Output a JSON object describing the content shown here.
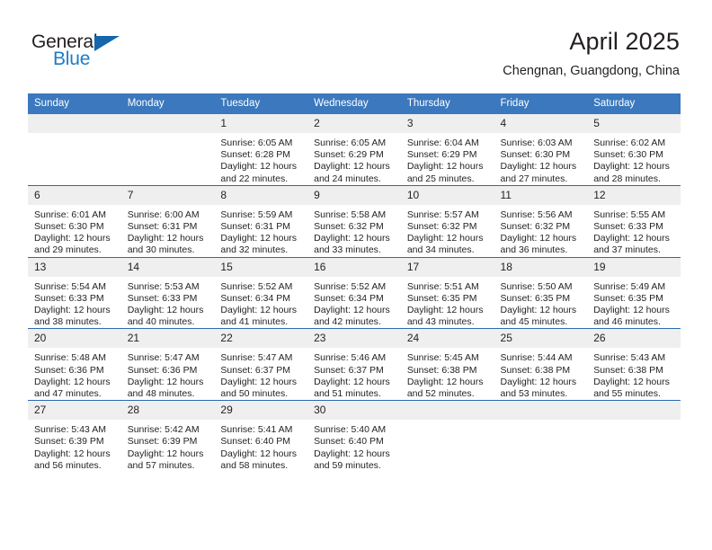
{
  "brand": {
    "name_part1": "General",
    "name_part2": "Blue",
    "triangle_icon": "triangle-icon",
    "accent_blue": "#1c7cc7",
    "triangle_blue": "#1566ab"
  },
  "header": {
    "title": "April 2025",
    "location": "Chengnan, Guangdong, China"
  },
  "theme": {
    "header_row_bg": "#3b78bd",
    "day_band_bg": "#efefef",
    "row_divider": "#2a6aae",
    "text": "#231f20"
  },
  "weekday_headers": [
    "Sunday",
    "Monday",
    "Tuesday",
    "Wednesday",
    "Thursday",
    "Friday",
    "Saturday"
  ],
  "weeks": [
    [
      {
        "day": "",
        "sunrise": "",
        "sunset": "",
        "daylight_line1": "",
        "daylight_line2": ""
      },
      {
        "day": "",
        "sunrise": "",
        "sunset": "",
        "daylight_line1": "",
        "daylight_line2": ""
      },
      {
        "day": "1",
        "sunrise": "Sunrise: 6:05 AM",
        "sunset": "Sunset: 6:28 PM",
        "daylight_line1": "Daylight: 12 hours",
        "daylight_line2": "and 22 minutes."
      },
      {
        "day": "2",
        "sunrise": "Sunrise: 6:05 AM",
        "sunset": "Sunset: 6:29 PM",
        "daylight_line1": "Daylight: 12 hours",
        "daylight_line2": "and 24 minutes."
      },
      {
        "day": "3",
        "sunrise": "Sunrise: 6:04 AM",
        "sunset": "Sunset: 6:29 PM",
        "daylight_line1": "Daylight: 12 hours",
        "daylight_line2": "and 25 minutes."
      },
      {
        "day": "4",
        "sunrise": "Sunrise: 6:03 AM",
        "sunset": "Sunset: 6:30 PM",
        "daylight_line1": "Daylight: 12 hours",
        "daylight_line2": "and 27 minutes."
      },
      {
        "day": "5",
        "sunrise": "Sunrise: 6:02 AM",
        "sunset": "Sunset: 6:30 PM",
        "daylight_line1": "Daylight: 12 hours",
        "daylight_line2": "and 28 minutes."
      }
    ],
    [
      {
        "day": "6",
        "sunrise": "Sunrise: 6:01 AM",
        "sunset": "Sunset: 6:30 PM",
        "daylight_line1": "Daylight: 12 hours",
        "daylight_line2": "and 29 minutes."
      },
      {
        "day": "7",
        "sunrise": "Sunrise: 6:00 AM",
        "sunset": "Sunset: 6:31 PM",
        "daylight_line1": "Daylight: 12 hours",
        "daylight_line2": "and 30 minutes."
      },
      {
        "day": "8",
        "sunrise": "Sunrise: 5:59 AM",
        "sunset": "Sunset: 6:31 PM",
        "daylight_line1": "Daylight: 12 hours",
        "daylight_line2": "and 32 minutes."
      },
      {
        "day": "9",
        "sunrise": "Sunrise: 5:58 AM",
        "sunset": "Sunset: 6:32 PM",
        "daylight_line1": "Daylight: 12 hours",
        "daylight_line2": "and 33 minutes."
      },
      {
        "day": "10",
        "sunrise": "Sunrise: 5:57 AM",
        "sunset": "Sunset: 6:32 PM",
        "daylight_line1": "Daylight: 12 hours",
        "daylight_line2": "and 34 minutes."
      },
      {
        "day": "11",
        "sunrise": "Sunrise: 5:56 AM",
        "sunset": "Sunset: 6:32 PM",
        "daylight_line1": "Daylight: 12 hours",
        "daylight_line2": "and 36 minutes."
      },
      {
        "day": "12",
        "sunrise": "Sunrise: 5:55 AM",
        "sunset": "Sunset: 6:33 PM",
        "daylight_line1": "Daylight: 12 hours",
        "daylight_line2": "and 37 minutes."
      }
    ],
    [
      {
        "day": "13",
        "sunrise": "Sunrise: 5:54 AM",
        "sunset": "Sunset: 6:33 PM",
        "daylight_line1": "Daylight: 12 hours",
        "daylight_line2": "and 38 minutes."
      },
      {
        "day": "14",
        "sunrise": "Sunrise: 5:53 AM",
        "sunset": "Sunset: 6:33 PM",
        "daylight_line1": "Daylight: 12 hours",
        "daylight_line2": "and 40 minutes."
      },
      {
        "day": "15",
        "sunrise": "Sunrise: 5:52 AM",
        "sunset": "Sunset: 6:34 PM",
        "daylight_line1": "Daylight: 12 hours",
        "daylight_line2": "and 41 minutes."
      },
      {
        "day": "16",
        "sunrise": "Sunrise: 5:52 AM",
        "sunset": "Sunset: 6:34 PM",
        "daylight_line1": "Daylight: 12 hours",
        "daylight_line2": "and 42 minutes."
      },
      {
        "day": "17",
        "sunrise": "Sunrise: 5:51 AM",
        "sunset": "Sunset: 6:35 PM",
        "daylight_line1": "Daylight: 12 hours",
        "daylight_line2": "and 43 minutes."
      },
      {
        "day": "18",
        "sunrise": "Sunrise: 5:50 AM",
        "sunset": "Sunset: 6:35 PM",
        "daylight_line1": "Daylight: 12 hours",
        "daylight_line2": "and 45 minutes."
      },
      {
        "day": "19",
        "sunrise": "Sunrise: 5:49 AM",
        "sunset": "Sunset: 6:35 PM",
        "daylight_line1": "Daylight: 12 hours",
        "daylight_line2": "and 46 minutes."
      }
    ],
    [
      {
        "day": "20",
        "sunrise": "Sunrise: 5:48 AM",
        "sunset": "Sunset: 6:36 PM",
        "daylight_line1": "Daylight: 12 hours",
        "daylight_line2": "and 47 minutes."
      },
      {
        "day": "21",
        "sunrise": "Sunrise: 5:47 AM",
        "sunset": "Sunset: 6:36 PM",
        "daylight_line1": "Daylight: 12 hours",
        "daylight_line2": "and 48 minutes."
      },
      {
        "day": "22",
        "sunrise": "Sunrise: 5:47 AM",
        "sunset": "Sunset: 6:37 PM",
        "daylight_line1": "Daylight: 12 hours",
        "daylight_line2": "and 50 minutes."
      },
      {
        "day": "23",
        "sunrise": "Sunrise: 5:46 AM",
        "sunset": "Sunset: 6:37 PM",
        "daylight_line1": "Daylight: 12 hours",
        "daylight_line2": "and 51 minutes."
      },
      {
        "day": "24",
        "sunrise": "Sunrise: 5:45 AM",
        "sunset": "Sunset: 6:38 PM",
        "daylight_line1": "Daylight: 12 hours",
        "daylight_line2": "and 52 minutes."
      },
      {
        "day": "25",
        "sunrise": "Sunrise: 5:44 AM",
        "sunset": "Sunset: 6:38 PM",
        "daylight_line1": "Daylight: 12 hours",
        "daylight_line2": "and 53 minutes."
      },
      {
        "day": "26",
        "sunrise": "Sunrise: 5:43 AM",
        "sunset": "Sunset: 6:38 PM",
        "daylight_line1": "Daylight: 12 hours",
        "daylight_line2": "and 55 minutes."
      }
    ],
    [
      {
        "day": "27",
        "sunrise": "Sunrise: 5:43 AM",
        "sunset": "Sunset: 6:39 PM",
        "daylight_line1": "Daylight: 12 hours",
        "daylight_line2": "and 56 minutes."
      },
      {
        "day": "28",
        "sunrise": "Sunrise: 5:42 AM",
        "sunset": "Sunset: 6:39 PM",
        "daylight_line1": "Daylight: 12 hours",
        "daylight_line2": "and 57 minutes."
      },
      {
        "day": "29",
        "sunrise": "Sunrise: 5:41 AM",
        "sunset": "Sunset: 6:40 PM",
        "daylight_line1": "Daylight: 12 hours",
        "daylight_line2": "and 58 minutes."
      },
      {
        "day": "30",
        "sunrise": "Sunrise: 5:40 AM",
        "sunset": "Sunset: 6:40 PM",
        "daylight_line1": "Daylight: 12 hours",
        "daylight_line2": "and 59 minutes."
      },
      {
        "day": "",
        "sunrise": "",
        "sunset": "",
        "daylight_line1": "",
        "daylight_line2": ""
      },
      {
        "day": "",
        "sunrise": "",
        "sunset": "",
        "daylight_line1": "",
        "daylight_line2": ""
      },
      {
        "day": "",
        "sunrise": "",
        "sunset": "",
        "daylight_line1": "",
        "daylight_line2": ""
      }
    ]
  ]
}
